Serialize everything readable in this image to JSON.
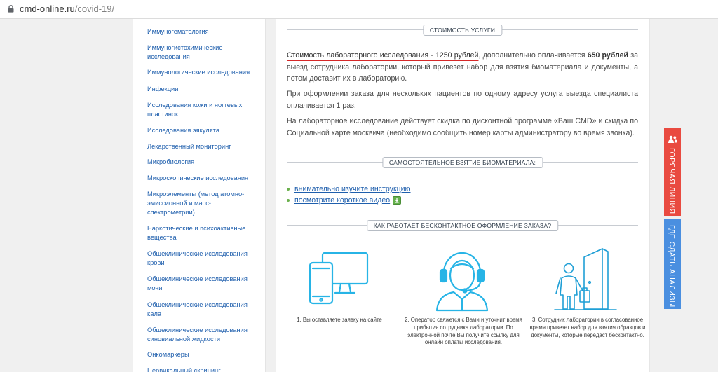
{
  "browser": {
    "domain": "cmd-online.ru",
    "path": "/covid-19/"
  },
  "sidebar": {
    "items": [
      "Иммуногематология",
      "Иммуногистохимические исследования",
      "Иммунологические исследования",
      "Инфекции",
      "Исследования кожи и ногтевых пластинок",
      "Исследования эякулята",
      "Лекарственный мониторинг",
      "Микробиология",
      "Микроскопические исследования",
      "Микроэлементы (метод атомно-эмиссионной и масс-спектрометрии)",
      "Наркотические и психоактивные вещества",
      "Общеклинические исследования крови",
      "Общеклинические исследования мочи",
      "Общеклинические исследования кала",
      "Общеклинические исследования синовиальной жидкости",
      "Онкомаркеры",
      "Цервикальный скрининг"
    ]
  },
  "main": {
    "cost_header": "СТОИМОСТЬ УСЛУГИ",
    "cost_text_emph": "Стоимость лабораторного исследования - 1250 рублей",
    "cost_text_mid": ", дополнительно оплачивается ",
    "cost_text_bold": "650 рублей",
    "cost_text_rest": " за выезд сотрудника лаборатории, который привезет набор для взятия биоматериала и документы, а потом доставит их в лабораторию.",
    "multi_patient_text": "При оформлении заказа для нескольких пациентов по одному адресу услуга выезда специалиста оплачивается 1 раз.",
    "discount_text": "На лабораторное исследование действует скидка по дисконтной программе «Ваш CMD» и скидка по Социальной карте москвича (необходимо сообщить номер карты администратору во время звонка).",
    "self_header": "САМОСТОЯТЕЛЬНОЕ ВЗЯТИЕ БИОМАТЕРИАЛА:",
    "link_instruction": "внимательно изучите инструкцию",
    "link_video": "посмотрите короткое видео",
    "contactless_header": "КАК РАБОТАЕТ БЕСКОНТАКТНОЕ ОФОРМЛЕНИЕ ЗАКАЗА?",
    "steps": [
      {
        "icon": "devices-icon",
        "caption": "1. Вы оставляете заявку на сайте"
      },
      {
        "icon": "operator-headset-icon",
        "caption": "2. Оператор свяжется с Вами и уточнит время прибытия сотрудника лаборатории. По электронной почте Вы получите ссылку для онлайн оплаты исследования."
      },
      {
        "icon": "courier-door-icon",
        "caption": "3. Сотрудник лаборатории в согласованное время привезет набор для взятия образцов и документы, которые передаст бесконтактно."
      }
    ]
  },
  "side_tabs": {
    "hotline": "ГОРЯЧАЯ ЛИНИЯ",
    "where_test": "ГДЕ СДАТЬ АНАЛИЗЫ"
  },
  "colors": {
    "link": "#1f5fad",
    "accent_red": "#e94a40",
    "accent_blue": "#4a8fe0",
    "icon_cyan": "#27b4e6",
    "bullet_green": "#6ab04c"
  }
}
